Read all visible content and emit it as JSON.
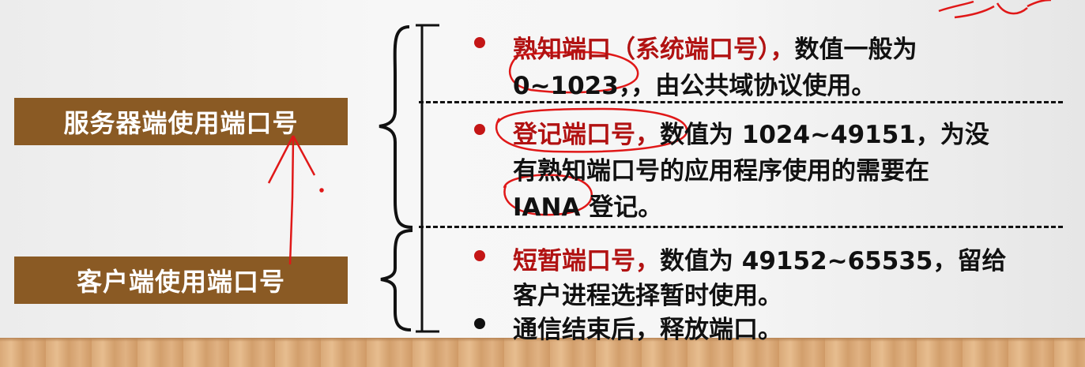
{
  "left_labels": {
    "server": "服务器端使用端口号",
    "client": "客户端使用端口号"
  },
  "well_known": {
    "term": "熟知端口（系统端口号），",
    "desc1": "数值一般为",
    "desc2": "0~1023，，由公共域协议使用。"
  },
  "registered": {
    "term": "登记端口号，",
    "desc1": "数值为 1024~49151，为没",
    "desc2": "有熟知端口号的应用程序使用的需要在",
    "desc3": "IANA 登记。"
  },
  "ephemeral": {
    "term": "短暂端口号，",
    "desc1": "数值为 49152~65535，留给",
    "desc2": "客户进程选择暂时使用。",
    "bullet2": "通信结束后，释放端口。"
  },
  "colors": {
    "accent_red": "#b11212",
    "label_brown": "#8a5a24",
    "annotation_red": "#e01818"
  }
}
